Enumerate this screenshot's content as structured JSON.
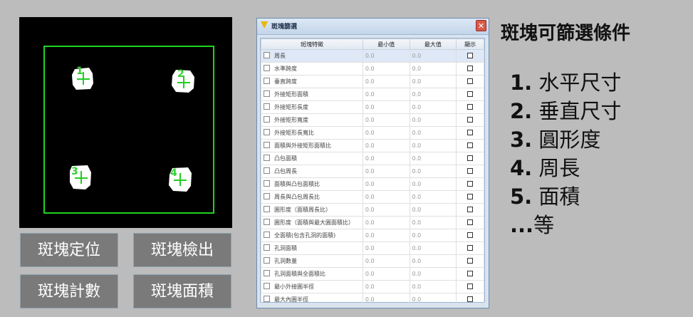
{
  "preview": {
    "blobs": [
      {
        "num": "1"
      },
      {
        "num": "2"
      },
      {
        "num": "3"
      },
      {
        "num": "4"
      }
    ]
  },
  "buttons": {
    "locate": "斑塊定位",
    "detect": "斑塊檢出",
    "count": "斑塊計數",
    "area": "斑塊面積"
  },
  "dialog": {
    "title": "斑塊篩選",
    "close": "✕",
    "columns": [
      "斑塊特徵",
      "最小值",
      "最大值",
      "顯示"
    ],
    "rows": [
      {
        "label": "周長",
        "min": "0.0",
        "max": "0.0"
      },
      {
        "label": "水準跨度",
        "min": "0.0",
        "max": "0.0"
      },
      {
        "label": "垂直跨度",
        "min": "0.0",
        "max": "0.0"
      },
      {
        "label": "外接矩形面積",
        "min": "0.0",
        "max": "0.0"
      },
      {
        "label": "外接矩形長度",
        "min": "0.0",
        "max": "0.0"
      },
      {
        "label": "外接矩形寬度",
        "min": "0.0",
        "max": "0.0"
      },
      {
        "label": "外接矩形長寬比",
        "min": "0.0",
        "max": "0.0"
      },
      {
        "label": "面積與外接矩形面積比",
        "min": "0.0",
        "max": "0.0"
      },
      {
        "label": "凸包面積",
        "min": "0.0",
        "max": "0.0"
      },
      {
        "label": "凸包周長",
        "min": "0.0",
        "max": "0.0"
      },
      {
        "label": "面積與凸包面積比",
        "min": "0.0",
        "max": "0.0"
      },
      {
        "label": "周長與凸包周長比",
        "min": "0.0",
        "max": "0.0"
      },
      {
        "label": "圓形度（面積周長比）",
        "min": "0.0",
        "max": "0.0"
      },
      {
        "label": "圓形度（面積與最大圓面積比）",
        "min": "0.0",
        "max": "0.0"
      },
      {
        "label": "全面積(包含孔洞的面積)",
        "min": "0.0",
        "max": "0.0"
      },
      {
        "label": "孔洞面積",
        "min": "0.0",
        "max": "0.0"
      },
      {
        "label": "孔洞數量",
        "min": "0.0",
        "max": "0.0"
      },
      {
        "label": "孔洞面積與全面積比",
        "min": "0.0",
        "max": "0.0"
      },
      {
        "label": "最小外接圓半徑",
        "min": "0.0",
        "max": "0.0"
      },
      {
        "label": "最大內圓半徑",
        "min": "0.0",
        "max": "0.0"
      }
    ]
  },
  "panel": {
    "heading": "斑塊可篩選條件",
    "conditions": [
      {
        "num": "1.",
        "text": " 水平尺寸"
      },
      {
        "num": "2.",
        "text": " 垂直尺寸"
      },
      {
        "num": "3.",
        "text": " 圓形度"
      },
      {
        "num": "4.",
        "text": " 周長"
      },
      {
        "num": "5.",
        "text": " 面積"
      },
      {
        "num": "...",
        "text": "等"
      }
    ]
  }
}
